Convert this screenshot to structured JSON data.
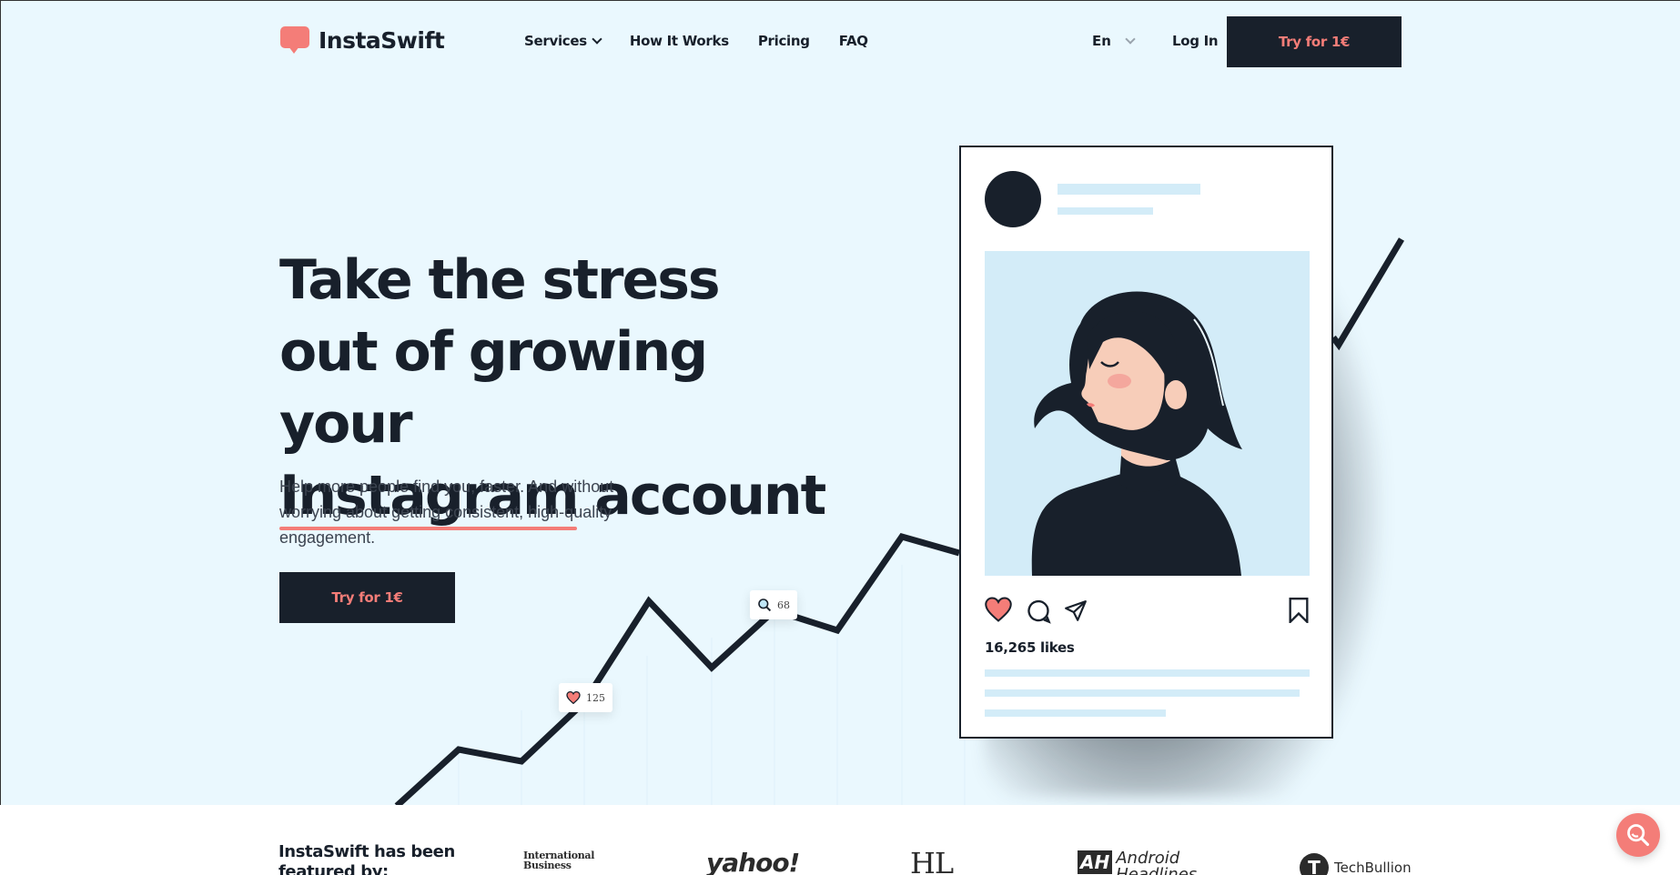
{
  "brand": {
    "name": "InstaSwift",
    "accent": "#f47d78",
    "dark": "#18202b",
    "hero_bg": "#eaf8fe"
  },
  "nav": {
    "items": [
      {
        "label": "Services",
        "has_dropdown": true
      },
      {
        "label": "How It Works"
      },
      {
        "label": "Pricing"
      },
      {
        "label": "FAQ"
      }
    ],
    "language": "En",
    "login": "Log In",
    "cta": "Try for 1€"
  },
  "hero": {
    "headline_line1": "Take the stress",
    "headline_line2": "out of growing your",
    "headline_line3_underlined": "Instagram",
    "headline_line3_rest": " account",
    "subtitle": "Help more people find you, faster. And without worrying about getting consistent, high-quality engagement.",
    "cta": "Try for 1€",
    "badges": [
      {
        "icon": "heart-icon",
        "count": "125"
      },
      {
        "icon": "search-icon",
        "count": "68"
      }
    ]
  },
  "post": {
    "likes": "16,265 likes",
    "icons": [
      "heart-icon",
      "comment-icon",
      "send-icon",
      "bookmark-icon"
    ]
  },
  "featured": {
    "label": "InstaSwift has been featured by:",
    "logos": {
      "ib_line1": "International",
      "ib_line2": "Business",
      "yahoo": "yahoo!",
      "hl": "HL",
      "ah_mark": "AH",
      "ah_line1": "Android",
      "ah_line2": "Headlines",
      "tb_mark": "T",
      "tb_text": "TechBullion"
    }
  },
  "help": {
    "icon": "search-help-icon"
  }
}
